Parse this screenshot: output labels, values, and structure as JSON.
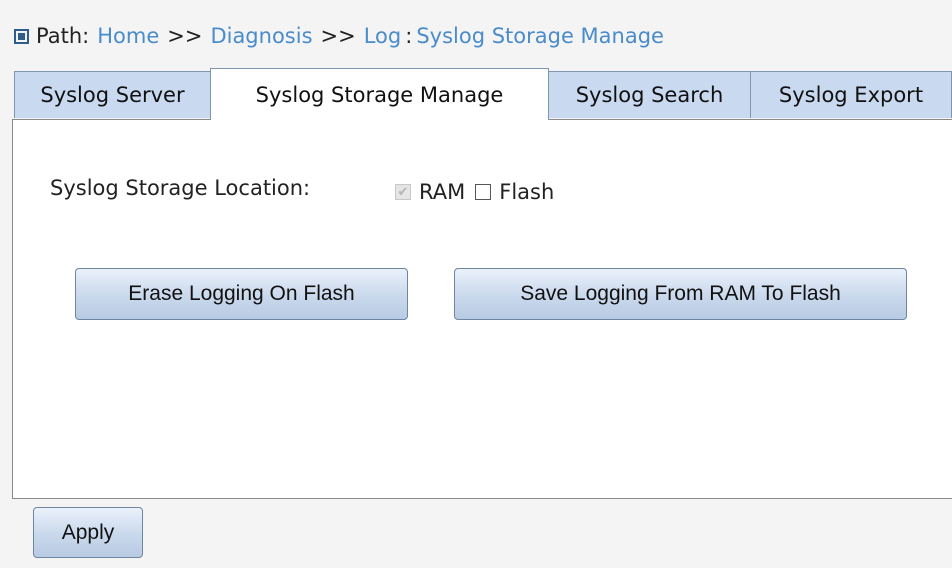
{
  "path": {
    "label": "Path:",
    "crumbs": [
      "Home",
      "Diagnosis",
      "Log",
      "Syslog Storage Manage"
    ],
    "separator": ">>",
    "colon": ":"
  },
  "tabs": [
    {
      "label": "Syslog Server",
      "active": false
    },
    {
      "label": "Syslog Storage Manage",
      "active": true
    },
    {
      "label": "Syslog Search",
      "active": false
    },
    {
      "label": "Syslog Export",
      "active": false
    }
  ],
  "storage": {
    "label": "Syslog Storage Location:",
    "options": [
      {
        "label": "RAM",
        "checked": true,
        "disabled": true
      },
      {
        "label": "Flash",
        "checked": false,
        "disabled": false
      }
    ]
  },
  "buttons": {
    "erase": "Erase Logging On Flash",
    "save": "Save Logging From RAM To Flash",
    "apply": "Apply"
  }
}
